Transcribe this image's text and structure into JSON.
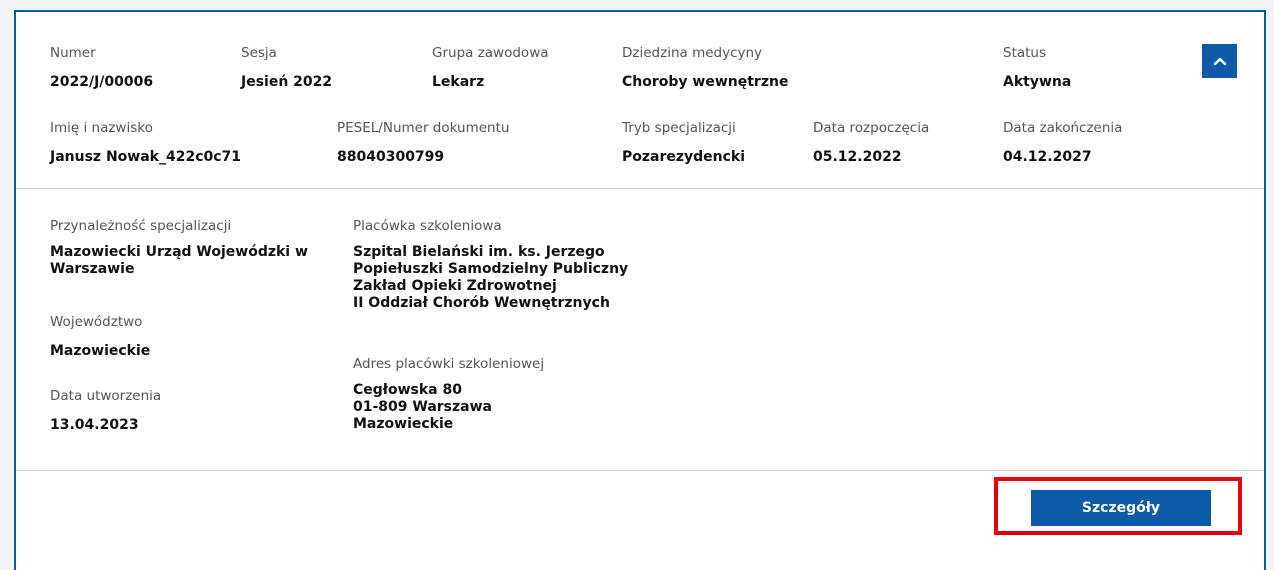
{
  "header_row1": {
    "numer": {
      "label": "Numer",
      "value": "2022/J/00006"
    },
    "sesja": {
      "label": "Sesja",
      "value": "Jesień 2022"
    },
    "grupa": {
      "label": "Grupa zawodowa",
      "value": "Lekarz"
    },
    "dziedzina": {
      "label": "Dziedzina medycyny",
      "value": "Choroby wewnętrzne"
    },
    "status": {
      "label": "Status",
      "value": "Aktywna"
    }
  },
  "header_row2": {
    "imie": {
      "label": "Imię i nazwisko",
      "value": "Janusz Nowak_422c0c71"
    },
    "pesel": {
      "label": "PESEL/Numer dokumentu",
      "value": "88040300799"
    },
    "tryb": {
      "label": "Tryb specjalizacji",
      "value": "Pozarezydencki"
    },
    "data_rozpoczecia": {
      "label": "Data rozpoczęcia",
      "value": "05.12.2022"
    },
    "data_zakonczenia": {
      "label": "Data zakończenia",
      "value": "04.12.2027"
    }
  },
  "details": {
    "przynaleznosc": {
      "label": "Przynależność specjalizacji",
      "value": "Mazowiecki Urząd Wojewódzki w Warszawie"
    },
    "wojewodztwo": {
      "label": "Województwo",
      "value": "Mazowieckie"
    },
    "data_utworzenia": {
      "label": "Data utworzenia",
      "value": "13.04.2023"
    },
    "placowka": {
      "label": "Placówka szkoleniowa",
      "lines": [
        "Szpital Bielański im. ks. Jerzego",
        "Popiełuszki Samodzielny Publiczny",
        "Zakład Opieki Zdrowotnej",
        "II Oddział Chorób Wewnętrznych"
      ]
    },
    "adres": {
      "label": "Adres placówki szkoleniowej",
      "lines": [
        "Cegłowska 80",
        "01-809 Warszawa",
        "Mazowieckie"
      ]
    }
  },
  "actions": {
    "details_label": "Szczegóły",
    "collapse_icon": "chevron-up-icon"
  },
  "colors": {
    "accent": "#0c5aa8",
    "highlight": "#e8000b"
  }
}
